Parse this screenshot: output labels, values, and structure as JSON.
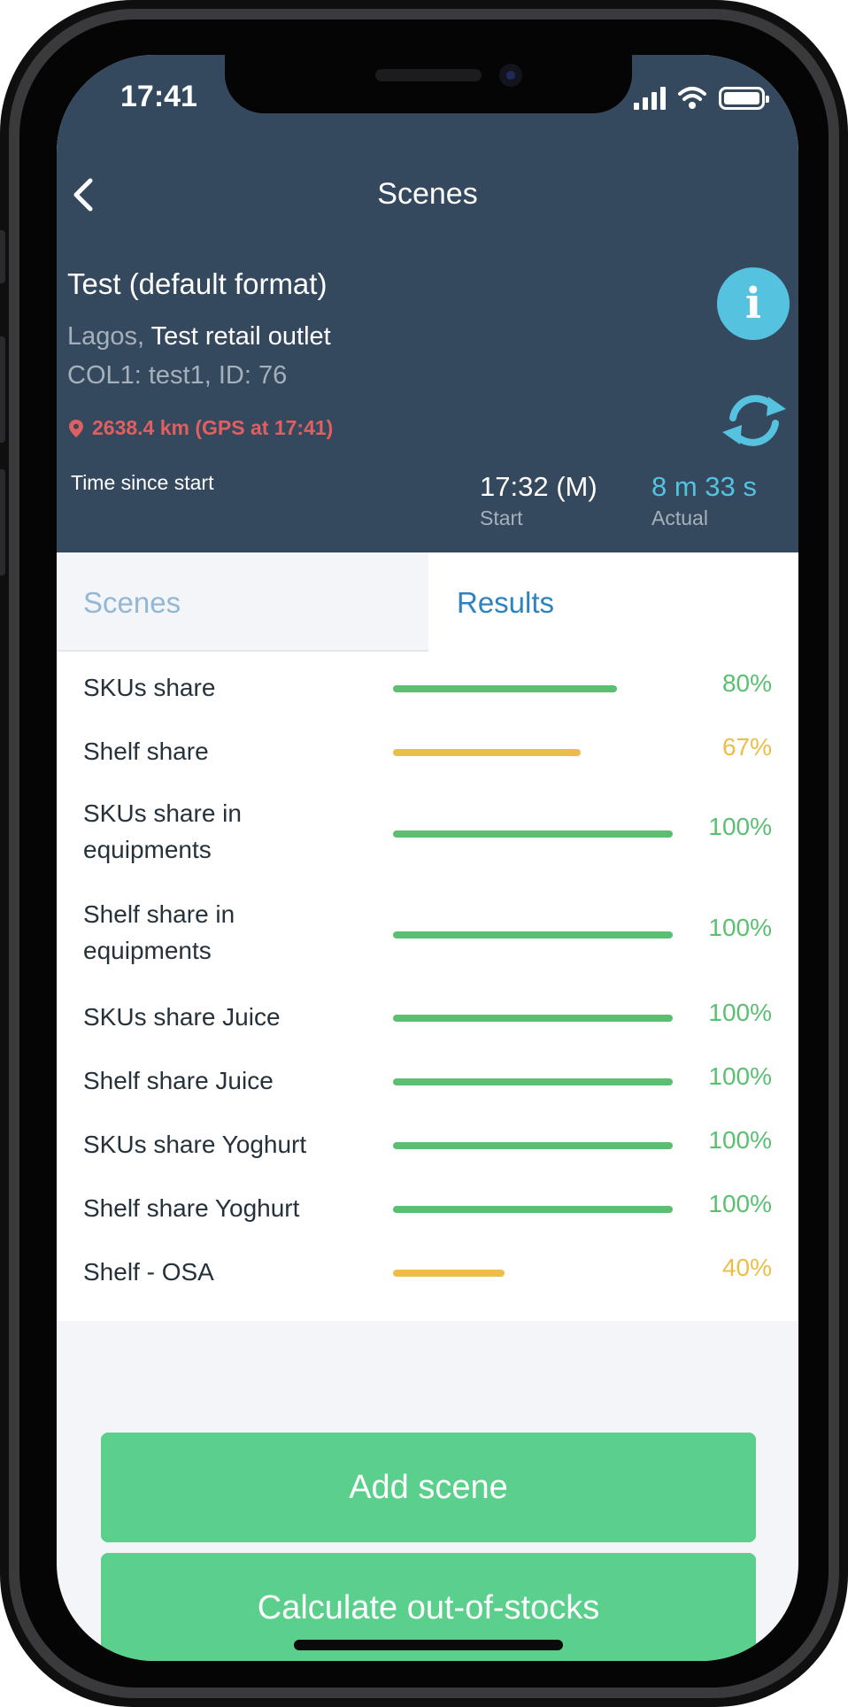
{
  "status_bar": {
    "time": "17:41"
  },
  "nav": {
    "title": "Scenes"
  },
  "visit": {
    "title": "Test (default format)",
    "city": "Lagos,",
    "outlet": "Test retail outlet",
    "id_line": "COL1: test1, ID: 76",
    "gps": "2638.4 km (GPS at 17:41)",
    "time_label": "Time since start",
    "start_value": "17:32 (M)",
    "start_label": "Start",
    "actual_value": "8 m 33 s",
    "actual_label": "Actual"
  },
  "tabs": [
    {
      "label": "Scenes",
      "active": false
    },
    {
      "label": "Results",
      "active": true
    }
  ],
  "results": [
    {
      "label": "SKUs share",
      "value": "80%",
      "fraction": 0.8,
      "color": "#5bbf72"
    },
    {
      "label": "Shelf share",
      "value": "67%",
      "fraction": 0.67,
      "color": "#ecbe48"
    },
    {
      "label": "SKUs share in equipments",
      "value": "100%",
      "fraction": 1.0,
      "color": "#5bbf72"
    },
    {
      "label": "Shelf share in equipments",
      "value": "100%",
      "fraction": 1.0,
      "color": "#5bbf72"
    },
    {
      "label": "SKUs share Juice",
      "value": "100%",
      "fraction": 1.0,
      "color": "#5bbf72"
    },
    {
      "label": "Shelf share Juice",
      "value": "100%",
      "fraction": 1.0,
      "color": "#5bbf72"
    },
    {
      "label": "SKUs share Yoghurt",
      "value": "100%",
      "fraction": 1.0,
      "color": "#5bbf72"
    },
    {
      "label": "Shelf share Yoghurt",
      "value": "100%",
      "fraction": 1.0,
      "color": "#5bbf72"
    },
    {
      "label": "Shelf - OSA",
      "value": "40%",
      "fraction": 0.4,
      "color": "#ecbe48"
    }
  ],
  "actions": {
    "add_scene": "Add scene",
    "calculate": "Calculate out-of-stocks"
  },
  "colors": {
    "header_bg": "#35495e",
    "accent_blue": "#55c2e0",
    "button_green": "#5bd08c",
    "gps_red": "#e05f60"
  }
}
